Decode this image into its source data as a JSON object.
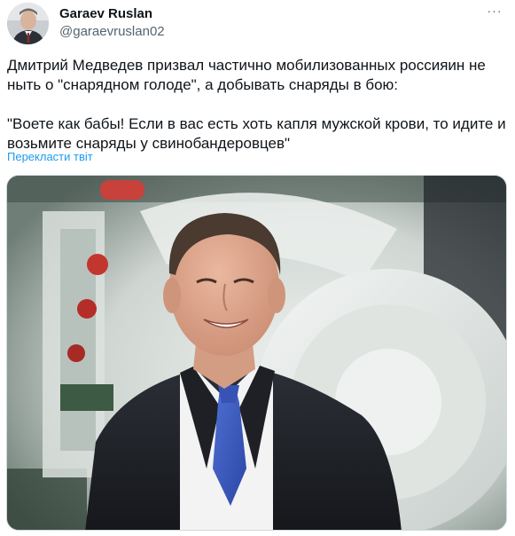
{
  "author": {
    "display_name": "Garaev Ruslan",
    "handle": "@garaevruslan02"
  },
  "more_menu_label": "···",
  "tweet": {
    "paragraph_1": "Дмитрий Медведев призвал частично мобилизованных россияин не ныть о \"снарядном голоде\", а добывать снаряды в бою:",
    "paragraph_2": "\"Воете как бабы! Если в вас есть хоть капля мужской крови, то идите и возьмите снаряды у свинобандеровцев\""
  },
  "translate_link": "Перекласти твіт",
  "colors": {
    "text": "#0f1419",
    "secondary": "#536471",
    "link": "#1d9bf0",
    "border": "#cfd9de"
  },
  "icons": {
    "more": "more-dots-icon"
  }
}
